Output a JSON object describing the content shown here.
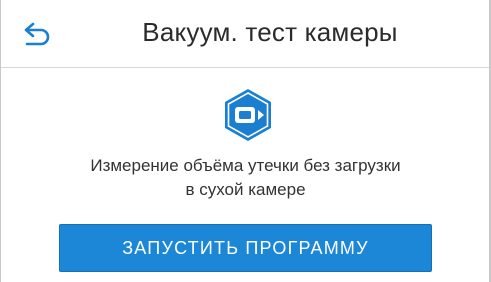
{
  "header": {
    "title": "Вакуум. тест камеры",
    "back_icon": "back-arrow-icon"
  },
  "program": {
    "icon": "vacuum-test-icon",
    "description_line1": "Измерение объёма утечки без загрузки",
    "description_line2": "в сухой камере"
  },
  "actions": {
    "start_label": "ЗАПУСТИТЬ ПРОГРАММУ"
  },
  "colors": {
    "accent": "#1c87d6",
    "icon_blue": "#1a7fd0"
  }
}
